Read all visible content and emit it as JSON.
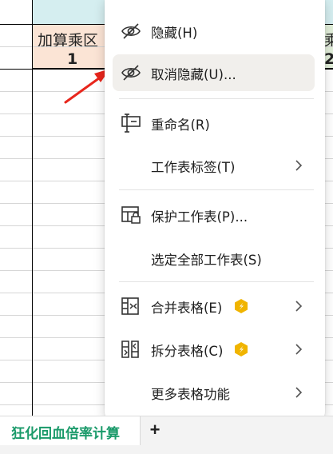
{
  "sheet": {
    "header_title": "加算乘区",
    "header_value": "1",
    "right_title_fragment": "乘",
    "right_value_fragment": "2"
  },
  "context_menu": {
    "items": [
      {
        "label": "隐藏(H)",
        "icon": "eye-off-icon"
      },
      {
        "label": "取消隐藏(U)...",
        "icon": "eye-off-icon",
        "highlighted": true
      },
      {
        "label": "重命名(R)",
        "icon": "rename-icon"
      },
      {
        "label": "工作表标签(T)",
        "icon": "",
        "submenu": true
      },
      {
        "label": "保护工作表(P)...",
        "icon": "protect-sheet-icon"
      },
      {
        "label": "选定全部工作表(S)",
        "icon": ""
      },
      {
        "label": "合并表格(E)",
        "icon": "merge-table-icon",
        "premium": true,
        "submenu": true
      },
      {
        "label": "拆分表格(C)",
        "icon": "split-table-icon",
        "premium": true,
        "submenu": true
      },
      {
        "label": "更多表格功能",
        "icon": "",
        "submenu": true
      }
    ]
  },
  "tabbar": {
    "active_tab": "狂化回血倍率计算",
    "add_label": "+"
  },
  "colors": {
    "header_teal": "#d5eef0",
    "header_peach": "#fbe4d5",
    "header_green": "#e2efda",
    "tab_green": "#1a9a6a",
    "arrow_red": "#e8261c",
    "premium_gold": "#f0b400",
    "menu_hover": "#f1efec"
  }
}
